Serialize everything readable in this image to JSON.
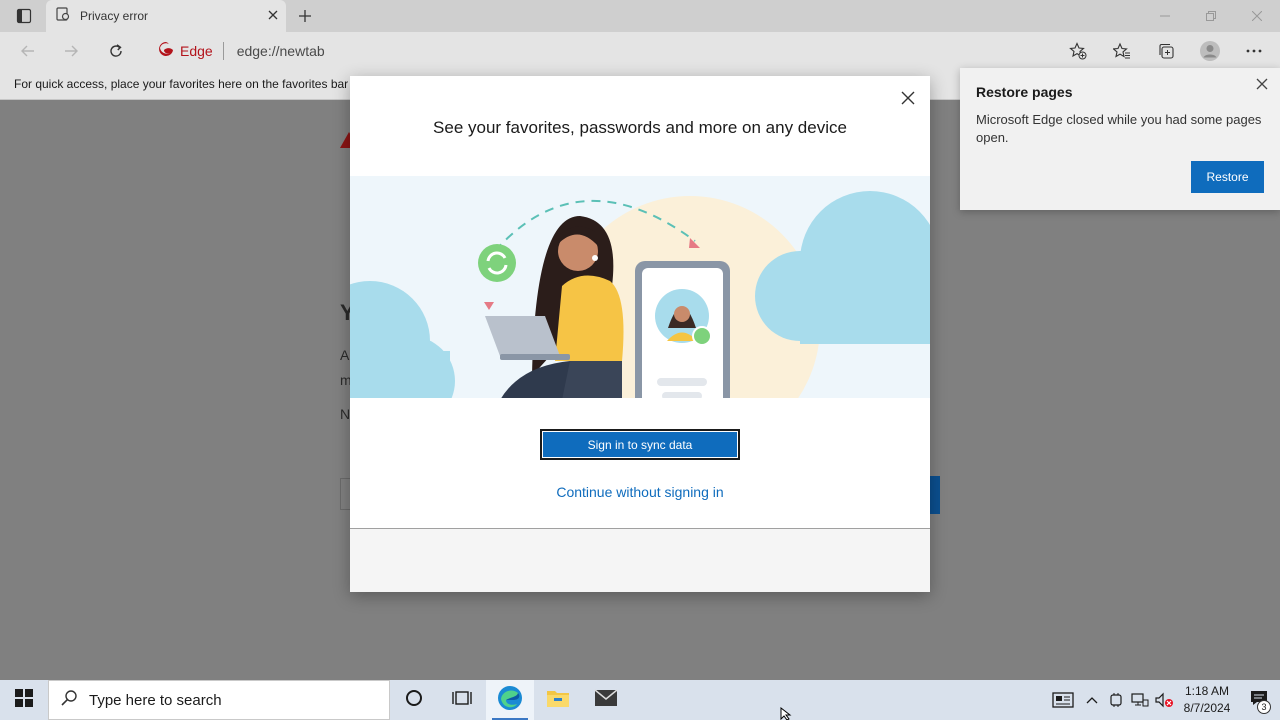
{
  "tab": {
    "title": "Privacy error"
  },
  "address": {
    "badge_label": "Edge",
    "url": "edge://newtab"
  },
  "favorites_bar": {
    "message": "For quick access, place your favorites here on the favorites bar"
  },
  "background_page": {
    "ghost_letter_1": "Y",
    "ghost_letter_2": "A",
    "ghost_letter_3": "m",
    "ghost_letter_4": "N"
  },
  "modal": {
    "title": "See your favorites, passwords and more on any device",
    "primary_button": "Sign in to sync data",
    "secondary_link": "Continue without signing in"
  },
  "restore_popup": {
    "title": "Restore pages",
    "message": "Microsoft Edge closed while you had some pages open.",
    "button": "Restore"
  },
  "taskbar": {
    "search_placeholder": "Type here to search",
    "time": "1:18 AM",
    "date": "8/7/2024",
    "notification_count": "3"
  },
  "colors": {
    "accent": "#0f6cbd",
    "edge_red": "#b3131b",
    "taskbar": "#d9e1ec"
  }
}
